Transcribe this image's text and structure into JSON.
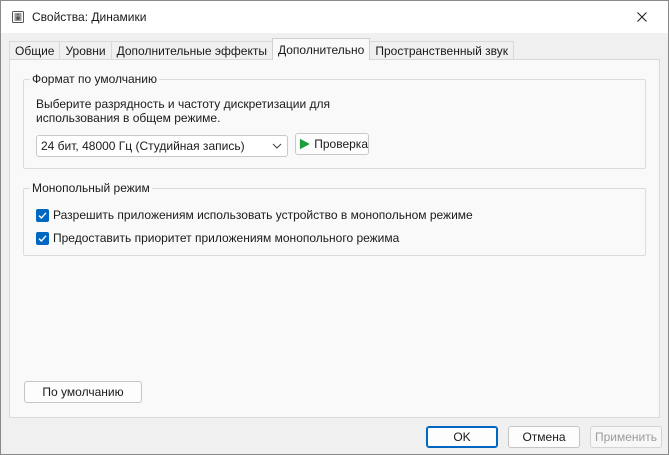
{
  "window": {
    "title": "Свойства: Динамики",
    "close_glyph": "✕"
  },
  "tabs": [
    {
      "label": "Общие",
      "active": false
    },
    {
      "label": "Уровни",
      "active": false
    },
    {
      "label": "Дополнительные эффекты",
      "active": false
    },
    {
      "label": "Дополнительно",
      "active": true
    },
    {
      "label": "Пространственный звук",
      "active": false
    }
  ],
  "default_format": {
    "group_label": "Формат по умолчанию",
    "description": "Выберите разрядность и частоту дискретизации для\nиспользования в общем режиме.",
    "selected_format": "24 бит, 48000 Гц (Студийная запись)",
    "test_button_label": "Проверка"
  },
  "exclusive_mode": {
    "group_label": "Монопольный режим",
    "options": [
      {
        "label": "Разрешить приложениям использовать устройство в монопольном режиме",
        "checked": true
      },
      {
        "label": "Предоставить приоритет приложениям монопольного режима",
        "checked": true
      }
    ]
  },
  "buttons": {
    "restore_defaults": "По умолчанию",
    "ok": "OK",
    "cancel": "Отмена",
    "apply": "Применить"
  },
  "colors": {
    "accent": "#0067c0",
    "play_icon": "#1e9e3a",
    "window_bg": "#f0f0f0",
    "panel_bg": "#f9f9f9"
  },
  "icons": {
    "title": "speaker-properties-icon",
    "close": "close-icon",
    "dropdown": "chevron-down-icon",
    "test": "play-icon",
    "check": "checkmark-icon"
  }
}
